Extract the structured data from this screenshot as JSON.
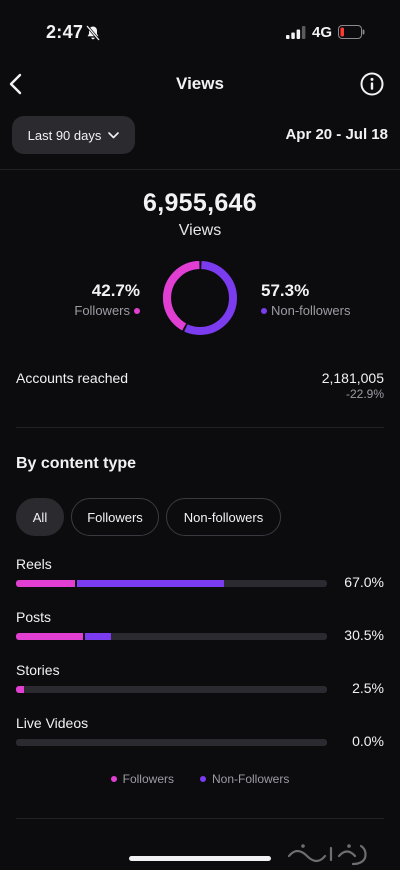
{
  "status_bar": {
    "time": "2:47",
    "network": "4G"
  },
  "header": {
    "title": "Views"
  },
  "range": {
    "label": "Last 90 days",
    "dates": "Apr 20 - Jul 18"
  },
  "summary": {
    "total": "6,955,646",
    "label": "Views",
    "followers_pct": "42.7%",
    "followers_label": "Followers",
    "nonfollowers_pct": "57.3%",
    "nonfollowers_label": "Non-followers",
    "followers_share": 0.427
  },
  "reach": {
    "label": "Accounts reached",
    "value": "2,181,005",
    "change": "-22.9%"
  },
  "content_type": {
    "title": "By content type",
    "filters": [
      "All",
      "Followers",
      "Non-followers"
    ],
    "active_filter": "All",
    "rows": [
      {
        "label": "Reels",
        "pct_text": "67.0%",
        "followers_pct": 19.0,
        "nonfollowers_pct": 48.0
      },
      {
        "label": "Posts",
        "pct_text": "30.5%",
        "followers_pct": 21.5,
        "nonfollowers_pct": 9.0
      },
      {
        "label": "Stories",
        "pct_text": "2.5%",
        "followers_pct": 2.5,
        "nonfollowers_pct": 0
      },
      {
        "label": "Live Videos",
        "pct_text": "0.0%",
        "followers_pct": 0,
        "nonfollowers_pct": 0
      }
    ],
    "legend": {
      "followers": "Followers",
      "nonfollowers": "Non-Followers"
    }
  },
  "colors": {
    "followers": "#e23fd2",
    "nonfollowers": "#7b3bee",
    "track": "#2a2a30",
    "background": "#0c0c0f"
  },
  "icons": {
    "back": "chevron-left-icon",
    "info": "info-icon",
    "dropdown": "chevron-down-icon",
    "silent": "bell-slash-icon",
    "signal": "signal-icon",
    "battery": "battery-low-icon"
  }
}
